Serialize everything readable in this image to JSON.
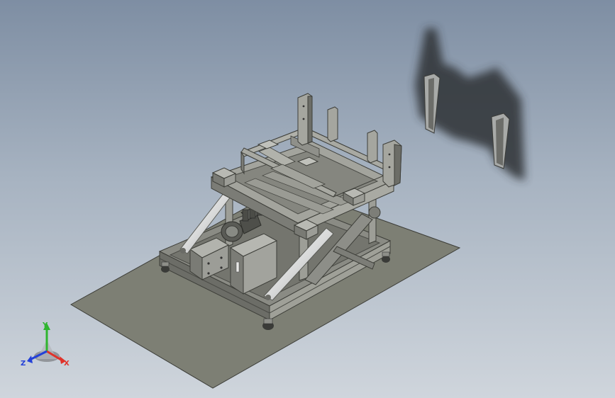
{
  "viewport": {
    "background_top": "#7e8ea3",
    "background_bottom": "#cfd5dc",
    "floor_color": "#7d7f74",
    "frame_color": "#9d9e97",
    "frame_dark": "#5e5f59",
    "shadow_color": "#2f3236"
  },
  "triad": {
    "x_label": "X",
    "y_label": "Y",
    "z_label": "Z",
    "x_color": "#e0322a",
    "y_color": "#2fb52f",
    "z_color": "#2340d8"
  }
}
